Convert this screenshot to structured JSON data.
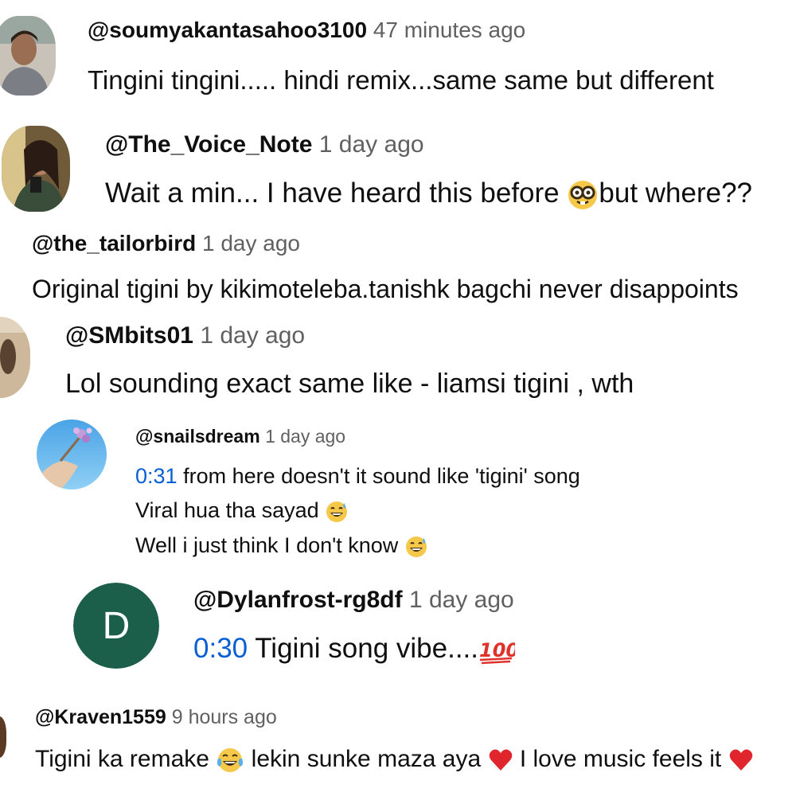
{
  "comments": [
    {
      "user": "@soumyakantasahoo3100",
      "time": "47 minutes ago",
      "lines": [
        "Tingini tingini..... hindi remix...same same but different"
      ]
    },
    {
      "user": "@The_Voice_Note",
      "time": "1 day ago",
      "text_before": "Wait a min... I have heard this before",
      "emoji": "nerd-face-emoji",
      "text_after": "but where??"
    },
    {
      "user": "@the_tailorbird",
      "time": "1 day ago",
      "lines": [
        "Original tigini by kikimoteleba.tanishk bagchi never disappoints"
      ]
    },
    {
      "user": "@SMbits01",
      "time": "1 day ago",
      "lines": [
        "Lol sounding exact same like - liamsi tigini , wth"
      ]
    },
    {
      "user": "@snailsdream",
      "time": "1 day ago",
      "timestamp": "0:31",
      "line1_rest": "from here doesn't it sound like 'tigini' song",
      "line2": "Viral hua tha sayad",
      "line3": "Well i just think I don't know",
      "emoji": "grinning-sweat-emoji"
    },
    {
      "user": "@Dylanfrost-rg8df",
      "time": "1 day ago",
      "avatar_letter": "D",
      "avatar_color": "#1b5e4a",
      "timestamp": "0:30",
      "text": "Tigini song vibe....",
      "emoji": "hundred-points-emoji"
    },
    {
      "user": "@Kraven1559",
      "time": "9 hours ago",
      "part1": "Tigini ka remake",
      "part2": "lekin sunke maza aya",
      "part3": "I love music feels it",
      "emojis": [
        "tears-of-joy-emoji",
        "red-heart-emoji"
      ]
    }
  ],
  "colors": {
    "link": "#065fd4",
    "meta": "#606060",
    "text": "#0f0f0f"
  }
}
